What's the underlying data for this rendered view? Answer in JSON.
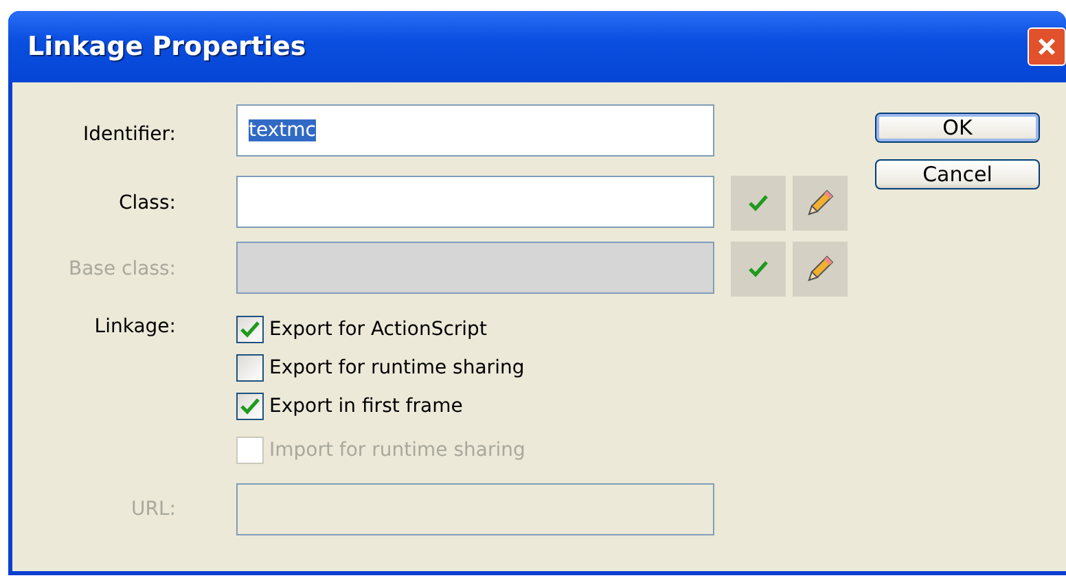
{
  "window": {
    "title": "Linkage Properties"
  },
  "fields": [
    {
      "label": "Identifier:",
      "value": "textmc",
      "value_selected": true,
      "disabled": false,
      "tools": false
    },
    {
      "label": "Class:",
      "disabled": false,
      "tools": true
    },
    {
      "label": "Base class:",
      "disabled": true,
      "tools": true
    }
  ],
  "linkage": {
    "label": "Linkage:",
    "options": [
      {
        "label": "Export for ActionScript",
        "checked": true,
        "disabled": false
      },
      {
        "label": "Export for runtime sharing",
        "checked": false,
        "disabled": false
      },
      {
        "label": "Export in first frame",
        "checked": true,
        "disabled": false
      },
      {
        "label": "Import for runtime sharing",
        "checked": false,
        "disabled": true
      }
    ]
  },
  "url": {
    "label": "URL:",
    "disabled": true
  },
  "buttons": [
    {
      "label": "OK",
      "default": true
    },
    {
      "label": "Cancel",
      "default": false
    }
  ]
}
